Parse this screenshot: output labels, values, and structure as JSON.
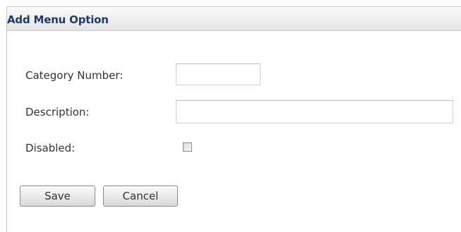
{
  "panel": {
    "title": "Add Menu Option"
  },
  "form": {
    "category_number": {
      "label": "Category Number:",
      "value": "",
      "placeholder": ""
    },
    "description": {
      "label": "Description:",
      "value": "",
      "placeholder": ""
    },
    "disabled": {
      "label": "Disabled:",
      "checked": false
    }
  },
  "actions": {
    "save_label": "Save",
    "cancel_label": "Cancel"
  },
  "colors": {
    "title_text": "#1f3b66",
    "label_text": "#333333",
    "header_bg": "#eeeeee",
    "border": "#c9c9c9"
  }
}
